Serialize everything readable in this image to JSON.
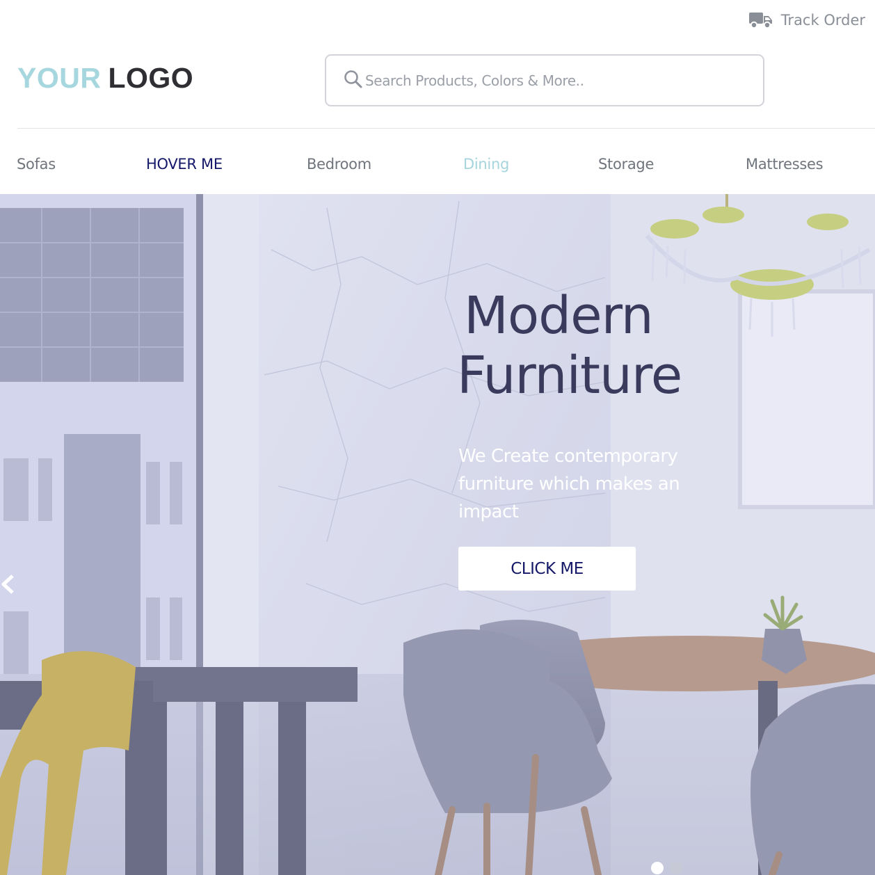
{
  "header": {
    "track_order_label": "Track Order",
    "truck_icon": "truck-icon",
    "logo": {
      "part1": "YOUR",
      "part2": "LOGO"
    },
    "search": {
      "placeholder": "Search Products, Colors & More..",
      "icon": "search-icon"
    }
  },
  "nav": {
    "items": [
      {
        "label": "Sofas"
      },
      {
        "label": "HOVER ME"
      },
      {
        "label": "Bedroom"
      },
      {
        "label": "Dining"
      },
      {
        "label": "Storage"
      },
      {
        "label": "Mattresses"
      }
    ]
  },
  "hero": {
    "title_line1": "Modern",
    "title_line2": "Furniture",
    "subtitle": "We Create contemporary furniture which makes an impact",
    "cta_label": "CLICK ME",
    "prev_icon": "chevron-left-icon",
    "slides_count": 2,
    "active_slide": 1
  },
  "colors": {
    "logo_accent": "#a6d6de",
    "logo_dark": "#2f2f33",
    "nav_text": "#70747c",
    "nav_hover": "#141868",
    "nav_active": "#a5d4dd",
    "hero_title": "#3a3a5c",
    "hero_overlay": "#cdd0e8"
  }
}
